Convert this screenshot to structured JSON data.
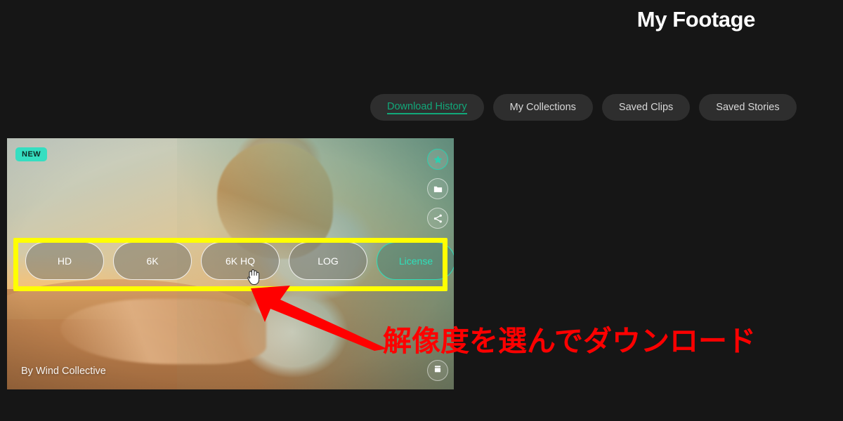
{
  "header": {
    "title": "My Footage"
  },
  "tabs": [
    {
      "label": "Download History",
      "active": true
    },
    {
      "label": "My Collections",
      "active": false
    },
    {
      "label": "Saved Clips",
      "active": false
    },
    {
      "label": "Saved Stories",
      "active": false
    }
  ],
  "card": {
    "badge": "NEW",
    "author": "By Wind Collective",
    "icons": {
      "favorite": "star-icon",
      "collection": "folder-icon",
      "share": "share-icon",
      "stack": "stack-icon"
    }
  },
  "download_options": [
    {
      "label": "HD",
      "type": "resolution"
    },
    {
      "label": "6K",
      "type": "resolution"
    },
    {
      "label": "6K HQ",
      "type": "resolution"
    },
    {
      "label": "LOG",
      "type": "resolution"
    },
    {
      "label": "License",
      "type": "license"
    }
  ],
  "annotation": {
    "text": "解像度を選んでダウンロード",
    "color": "#ff0000",
    "highlight_color": "#ffff00",
    "arrow_color": "#ff0000"
  },
  "colors": {
    "background": "#161616",
    "accent_teal": "#12a87a",
    "badge_teal": "#35dec1",
    "tab_bg": "#2e2e2e",
    "license_teal": "#2ee0bb"
  }
}
